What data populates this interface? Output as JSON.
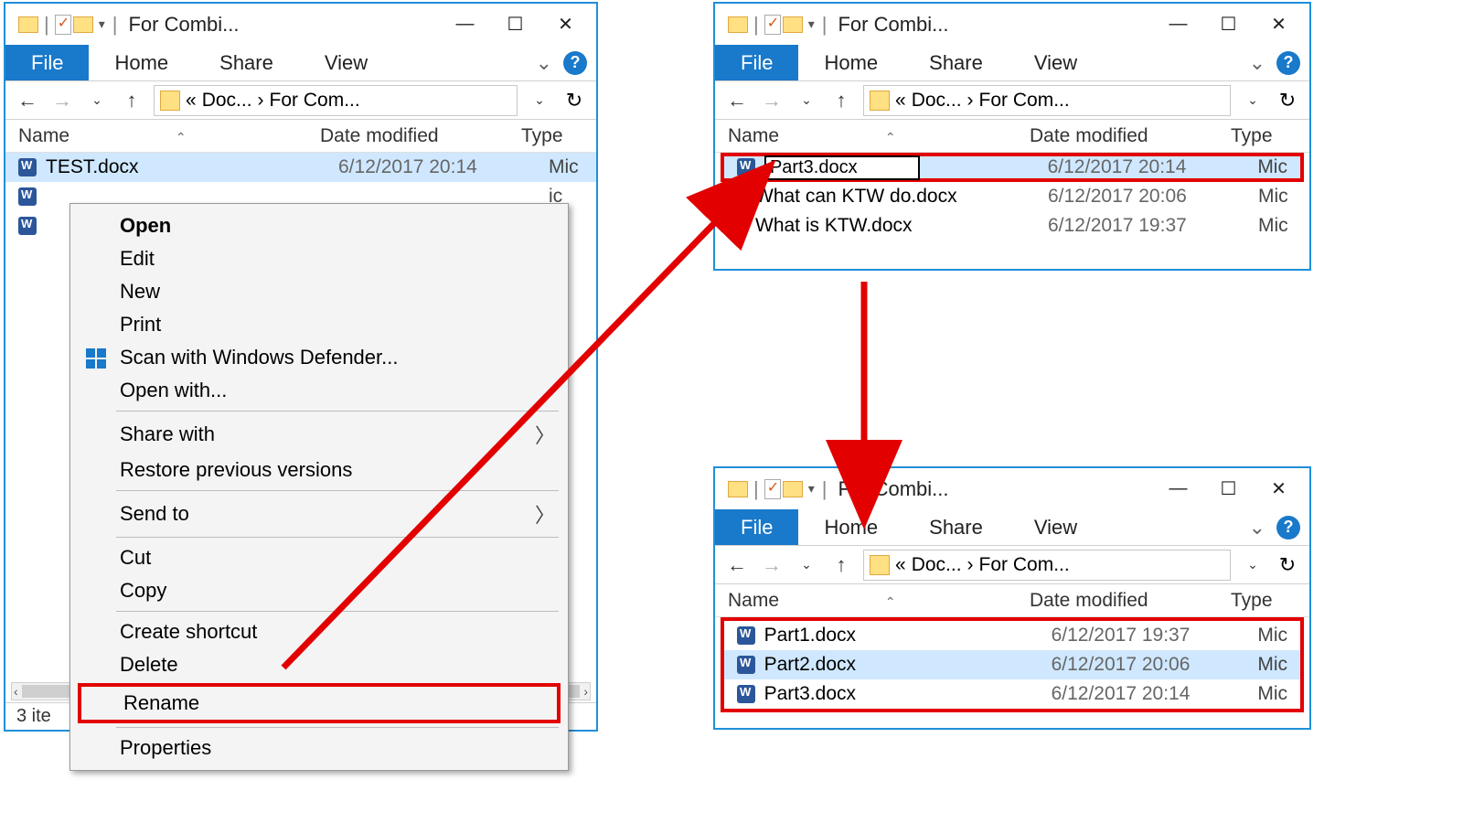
{
  "title": "For Combi...",
  "ribbon": {
    "file": "File",
    "home": "Home",
    "share": "Share",
    "view": "View",
    "help": "?"
  },
  "breadcrumb": {
    "laquo": "«",
    "seg1": "Doc...",
    "sep": "›",
    "seg2": "For Com..."
  },
  "columns": {
    "name": "Name",
    "date": "Date modified",
    "type": "Type"
  },
  "win1": {
    "files": [
      {
        "name": "TEST.docx",
        "date": "6/12/2017 20:14",
        "type": "Mic"
      }
    ],
    "status": "3 ite"
  },
  "ctx": {
    "open": "Open",
    "edit": "Edit",
    "new": "New",
    "print": "Print",
    "defender": "Scan with Windows Defender...",
    "openwith": "Open with...",
    "sharewith": "Share with",
    "restore": "Restore previous versions",
    "sendto": "Send to",
    "cut": "Cut",
    "copy": "Copy",
    "shortcut": "Create shortcut",
    "delete": "Delete",
    "rename": "Rename",
    "properties": "Properties"
  },
  "win2": {
    "rename_value": "Part3.docx",
    "files": [
      {
        "name": "What can KTW do.docx",
        "date": "6/12/2017 20:06",
        "type": "Mic"
      },
      {
        "name": "What is KTW.docx",
        "date": "6/12/2017 19:37",
        "type": "Mic"
      }
    ],
    "sel_date": "6/12/2017 20:14",
    "sel_type": "Mic"
  },
  "win3": {
    "files": [
      {
        "name": "Part1.docx",
        "date": "6/12/2017 19:37",
        "type": "Mic"
      },
      {
        "name": "Part2.docx",
        "date": "6/12/2017 20:06",
        "type": "Mic"
      },
      {
        "name": "Part3.docx",
        "date": "6/12/2017 20:14",
        "type": "Mic"
      }
    ]
  }
}
